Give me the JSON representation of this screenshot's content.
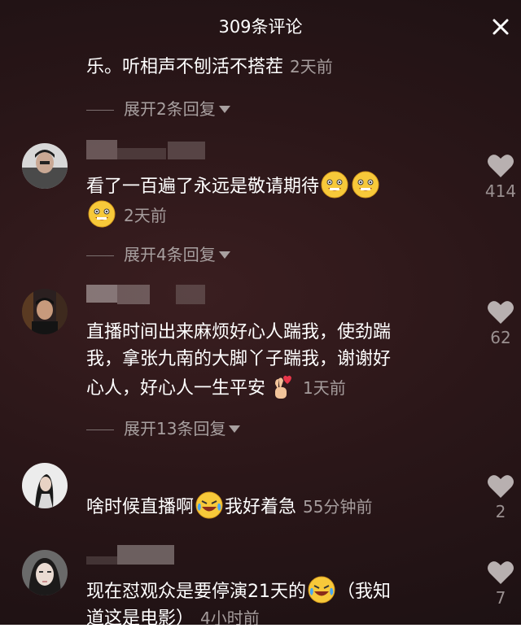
{
  "header": {
    "title": "309条评论"
  },
  "comments": [
    {
      "text": "乐。听相声不刨活不搭茬",
      "time": "2天前",
      "expand": "展开2条回复"
    },
    {
      "text": "看了一百遍了永远是敬请期待",
      "time": "2天前",
      "likes": "414",
      "expand": "展开4条回复",
      "emojis": [
        "grin-emoji",
        "grin-emoji",
        "grin-emoji"
      ]
    },
    {
      "lines": [
        "直播时间出来麻烦好心人踹我，使劲踹",
        "我，拿张九南的大脚丫子踹我，谢谢好",
        "心人，好心人一生平安"
      ],
      "time": "1天前",
      "likes": "62",
      "expand": "展开13条回复",
      "emojis": [
        "heart-fingers-emoji"
      ]
    },
    {
      "before": "啥时候直播啊",
      "after": "我好着急",
      "time": "55分钟前",
      "likes": "2",
      "emojis": [
        "rofl-emoji"
      ]
    },
    {
      "line1_before": "现在怼观众是要停演21天的",
      "line1_after": "（我知",
      "line2": "道这是电影）",
      "time": "4小时前",
      "likes": "7",
      "emojis": [
        "rofl-emoji"
      ]
    }
  ],
  "colors": {
    "background": "#2a1618",
    "secondary_text": "#a59c9c",
    "like_icon": "#b8b0b0"
  },
  "icons": [
    "close-icon",
    "heart-icon",
    "chevron-down-icon"
  ]
}
